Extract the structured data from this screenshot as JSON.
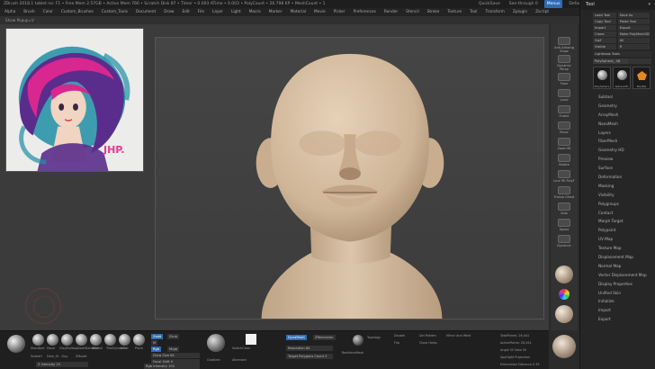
{
  "titlebar": {
    "left": "ZBrush 2018.1   tablet no: F1  •  Free Mem 2.57GB  •  Active Mem 766  •  Scratch Disk 87  •  Timer  •  0.003 ATime  •  0.003  •  PolyCount  •  26.798 KP  •  MeshCount  •  1",
    "right_items": [
      "QuickSave",
      "See-through 0",
      "Menus",
      "DefaultZScript"
    ],
    "window_buttons": [
      "?",
      "–",
      "▢",
      "✕"
    ]
  },
  "menubar": {
    "items": [
      "Alpha",
      "Brush",
      "Color",
      "Custom_Brushes",
      "Custom_Tools",
      "Document",
      "Draw",
      "Edit",
      "File",
      "Layer",
      "Light",
      "Macro",
      "Marker",
      "Material",
      "Movie",
      "Picker",
      "Preferences",
      "Render",
      "Stencil",
      "Stroke",
      "Texture",
      "Tool",
      "Transform",
      "Zplugin",
      "Zscript"
    ]
  },
  "subbar": {
    "label": "Show Popup=V"
  },
  "popup": {
    "signature": "JHP.",
    "colors": {
      "hair_pink": "#d8278f",
      "hair_purple": "#5a2d8c",
      "teal": "#1f8fa5",
      "skin": "#f1d4c2",
      "sig": "#e83a8d"
    }
  },
  "canvas": {
    "head_color": "#dcc4a8"
  },
  "right_tools": {
    "items": [
      {
        "label": "Anti-Aliasing Show"
      },
      {
        "label": "Dynamic Persp"
      },
      {
        "label": "Floor"
      },
      {
        "label": "Local"
      },
      {
        "label": "Frame"
      },
      {
        "label": "Move"
      },
      {
        "label": "Zoom3D"
      },
      {
        "label": "Rotate"
      },
      {
        "label": "Line Fill PolyF"
      },
      {
        "label": "Transp Ghost"
      },
      {
        "label": "Solo"
      },
      {
        "label": "Xpose"
      },
      {
        "label": "Dynamic"
      }
    ],
    "materials": [
      "#c8b8a4",
      "#e2e2e2",
      "#b5a48c"
    ],
    "swatches": [
      "#cc4e6a",
      "#bfa58f"
    ]
  },
  "toolpanel": {
    "title": "Tool",
    "buttons": [
      "Load Tool",
      "Save As",
      "Copy Tool",
      "Paste Tool",
      "Import",
      "Export",
      "Clone",
      "Make PolyMesh3D",
      "GoZ",
      "All",
      "Visible",
      "R"
    ],
    "lightbox": "Lightbox▸ Tools",
    "slider_label": "PolySphere_ 48",
    "slider_value": 48,
    "slider_fraction": 0.6,
    "thumbs": [
      "PolySphere",
      "Sphere3D",
      "PolyMe"
    ],
    "menu": [
      "Subtool",
      "Geometry",
      "ArrayMesh",
      "NanoMesh",
      "Layers",
      "FiberMesh",
      "Geometry HD",
      "Preview",
      "Surface",
      "Deformation",
      "Masking",
      "Visibility",
      "Polygroups",
      "Contact",
      "Morph Target",
      "Polypaint",
      "UV Map",
      "Texture Map",
      "Displacement Map",
      "Normal Map",
      "Vector Displacement Map",
      "Display Properties",
      "Unified Skin",
      "Initialize",
      "Import",
      "Export"
    ]
  },
  "shelf": {
    "brushes": [
      "Standard",
      "Move",
      "ClayBuildup",
      "DamStandard",
      "hPolish",
      "TrimDynamic",
      "Inflat",
      "Pinch",
      "SnakeH",
      "Dam_St",
      "Clay",
      "ZModel"
    ],
    "zadd": "Zadd",
    "zsub": "Zsub",
    "rgb": "Rgb",
    "mrgb": "Mrgb",
    "m": "M",
    "rgb_intensity_label": "Rgb Intensity",
    "rgb_intensity": 100,
    "draw_size_label": "Draw Size",
    "draw_size": 64,
    "z_intensity_label": "Z Intensity",
    "z_intensity": 25,
    "focal_shift_label": "Focal Shift",
    "focal_shift": 0,
    "switch_color": "SwitchColor",
    "gradient": "Gradient",
    "alternate": "Alternate",
    "dynamesh": "DynaMesh",
    "zremesher": "ZRemesher",
    "target_poly_label": "Target Polygons Count",
    "target_poly": 5,
    "resolution_label": "Resolution",
    "resolution": 64,
    "smooth_label": "SmoothSubdiv",
    "group_label": "Polypaint",
    "backface": "BackfaceMask",
    "double": "Double",
    "flip": "Flip",
    "topology": "Topology",
    "mirror_weld": "Mirror And Weld",
    "del_hidden": "Del Hidden",
    "close_holes": "Close Holes",
    "active_points_label": "ActivePoints",
    "active_points": "26,441",
    "total_points_label": "TotalPoints",
    "total_points": "26,441",
    "angle_of_view_label": "Angle Of View",
    "angle_of_view": 50,
    "spotlight": "Spotlight Projection",
    "elimination": "Elimination Distance",
    "elimination_value": "0.35"
  }
}
